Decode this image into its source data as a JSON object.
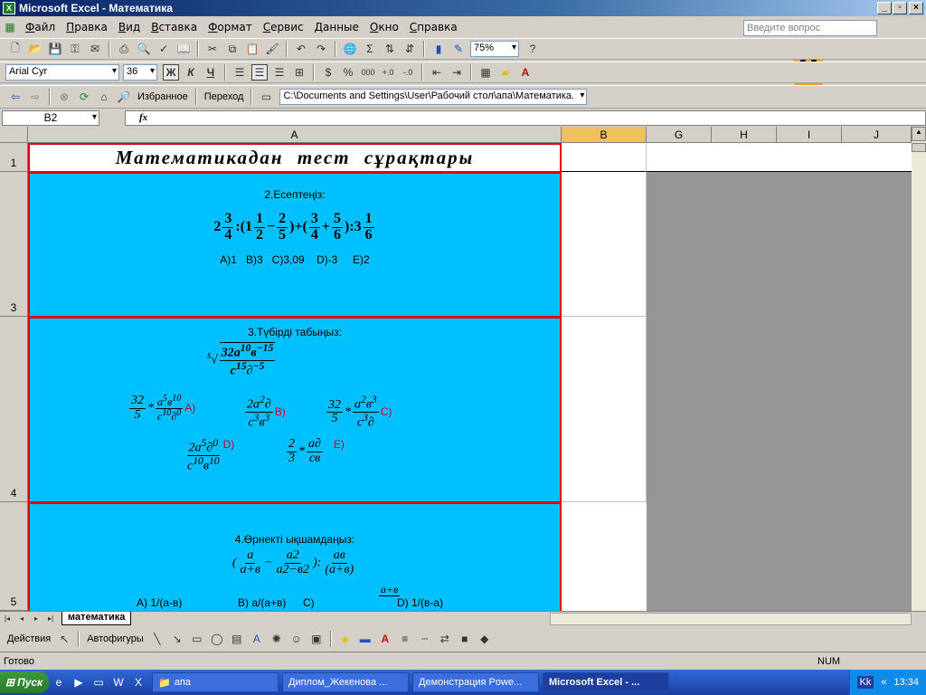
{
  "window": {
    "title": "Microsoft Excel - Математика",
    "app_icon": "excel-icon"
  },
  "menu": [
    "Файл",
    "Правка",
    "Вид",
    "Вставка",
    "Формат",
    "Сервис",
    "Данные",
    "Окно",
    "Справка"
  ],
  "help_box": {
    "placeholder": "Введите вопрос"
  },
  "toolbar_standard": {
    "zoom": "75%"
  },
  "toolbar_format": {
    "font": "Arial Cyr",
    "size": "36",
    "bold": "Ж",
    "italic": "К",
    "underline": "Ч"
  },
  "toolbar_web": {
    "favorites": "Избранное",
    "goto": "Переход",
    "address": "C:\\Documents and Settings\\User\\Рабочий стол\\апа\\Математика."
  },
  "formula_bar": {
    "name_box": "B2",
    "fx": "fx"
  },
  "columns": [
    "A",
    "B",
    "G",
    "H",
    "I",
    "J"
  ],
  "rows": [
    "1",
    "3",
    "4",
    "5"
  ],
  "sheet": {
    "title": "Математикадан тест сұрақтары",
    "q2": {
      "heading": "2.Есептеңіз:",
      "options": "A)1   B)3   C)3,09    D)-3     E)2"
    },
    "q3": {
      "heading": "3.Түбірді табыңыз:",
      "opt_a": "A)",
      "opt_b": "B)",
      "opt_c": "C)",
      "opt_d": "D)",
      "opt_e": "E)"
    },
    "q4": {
      "heading": "4.Өрнекті ықшамдаңыз:",
      "opt_a": "A) 1/(a-в)",
      "opt_b": "B) a/(a+в)",
      "opt_c": "C)",
      "opt_d": "D) 1/(в-a)"
    }
  },
  "sheet_tab": "математика",
  "drawing_bar": {
    "actions": "Действия",
    "autoshapes": "Автофигуры"
  },
  "status": {
    "ready": "Готово",
    "num": "NUM"
  },
  "taskbar": {
    "start": "Пуск",
    "tasks": [
      "апа",
      "Диплом_Жекенова ...",
      "Демонстрация Powe...",
      "Microsoft Excel - ..."
    ],
    "lang": "Kk",
    "clock": "13:34"
  }
}
